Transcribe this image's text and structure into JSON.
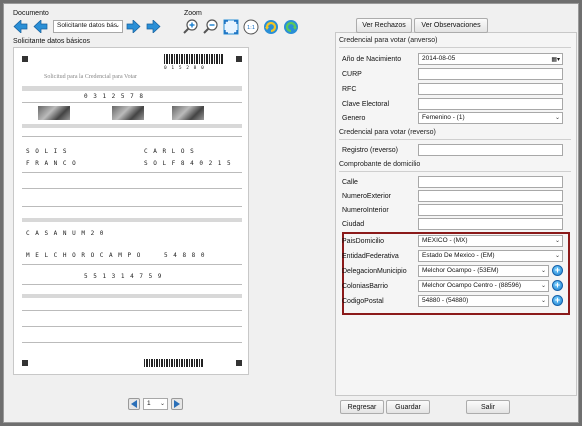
{
  "toolbar": {
    "documento_label": "Documento",
    "documento_value": "Solicitante datos bás",
    "zoom_label": "Zoom"
  },
  "viewer": {
    "title": "Solicitante datos básicos",
    "form": {
      "header": "Solicitud para la Credencial para Votar",
      "line1": "0 3  1 2  5  7  8",
      "name1": "S O L I S",
      "name2": "F R A N C O",
      "name3": "C A R L O S",
      "curp": "S O L F 8 4 0 2 1 5",
      "address1": "C A S A  N U M  2 0",
      "address2": "M E L C H O R  O C A M P O",
      "cp": "5 4 8 8 0",
      "phone": "5 5 1 3 1 4 7 5 9",
      "barcode_id": "0 1 5 2 8 0"
    }
  },
  "pagination": {
    "page_value": "1"
  },
  "buttons": {
    "ver_rechazos": "Ver Rechazos",
    "ver_observaciones": "Ver Observaciones",
    "regresar": "Regresar",
    "guardar": "Guardar",
    "salir": "Salir"
  },
  "credencial_anverso": {
    "title": "Credencial para votar (anverso)",
    "fields": [
      {
        "label": "Año de Nacimiento",
        "value": "2014-08-05"
      },
      {
        "label": "CURP",
        "value": ""
      },
      {
        "label": "RFC",
        "value": ""
      },
      {
        "label": "Clave Electoral",
        "value": ""
      },
      {
        "label": "Genero",
        "value": "Femenino - (1)"
      }
    ]
  },
  "credencial_reverso": {
    "title": "Credencial para votar (reverso)",
    "fields": [
      {
        "label": "Registro (reverso)",
        "value": ""
      }
    ]
  },
  "comprobante": {
    "title": "Comprobante de domicilio",
    "fields": [
      {
        "label": "Calle",
        "value": ""
      },
      {
        "label": "NumeroExterior",
        "value": ""
      },
      {
        "label": "NumeroInterior",
        "value": ""
      },
      {
        "label": "Ciudad",
        "value": ""
      }
    ],
    "selects": [
      {
        "label": "PaisDomicilio",
        "value": "MEXICO - (MX)"
      },
      {
        "label": "EntidadFederativa",
        "value": "Estado De Mexico - (EM)"
      },
      {
        "label": "DelegacionMunicipio",
        "value": "Melchor Ocampo - (53EM)"
      },
      {
        "label": "ColoniasBarrio",
        "value": "Melchor Ocampo Centro - (88596)"
      },
      {
        "label": "CodigoPostal",
        "value": "54880 - (54880)"
      }
    ]
  },
  "colors": {
    "highlight": "#8b1a1a",
    "nav_arrow": "#2a8fd6"
  }
}
